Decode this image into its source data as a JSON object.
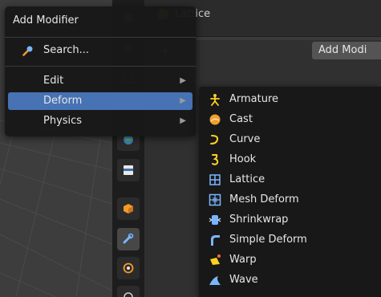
{
  "header": {
    "object_name": "Lattice",
    "add_modifier_button": "Add Modi",
    "plus_glyph": "+"
  },
  "menu": {
    "title": "Add Modifier",
    "search_label": "Search...",
    "items": [
      {
        "label": "Edit",
        "arrow": "▶"
      },
      {
        "label": "Deform",
        "arrow": "▶"
      },
      {
        "label": "Physics",
        "arrow": "▶"
      }
    ]
  },
  "submenu": {
    "items": [
      {
        "label": "Armature",
        "icon": "armature-icon"
      },
      {
        "label": "Cast",
        "icon": "cast-icon"
      },
      {
        "label": "Curve",
        "icon": "curve-icon"
      },
      {
        "label": "Hook",
        "icon": "hook-icon"
      },
      {
        "label": "Lattice",
        "icon": "lattice-icon"
      },
      {
        "label": "Mesh Deform",
        "icon": "mesh-deform-icon"
      },
      {
        "label": "Shrinkwrap",
        "icon": "shrinkwrap-icon"
      },
      {
        "label": "Simple Deform",
        "icon": "simple-deform-icon"
      },
      {
        "label": "Warp",
        "icon": "warp-icon"
      },
      {
        "label": "Wave",
        "icon": "wave-icon"
      }
    ]
  },
  "colors": {
    "highlight": "#4772b3",
    "menu_bg": "#181818",
    "icon_orange": "#f0a030",
    "icon_yellow": "#ffd21f",
    "icon_blue": "#7ab6ff"
  }
}
